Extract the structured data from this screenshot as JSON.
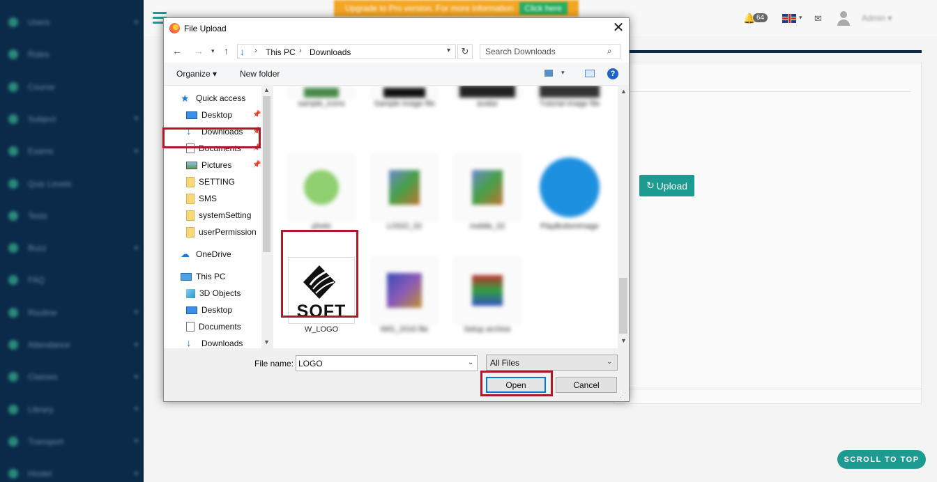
{
  "app": {
    "sidebar_items": [
      {
        "label": "Users",
        "caret": "▾"
      },
      {
        "label": "Roles",
        "caret": ""
      },
      {
        "label": "Course",
        "caret": ""
      },
      {
        "label": "Subject",
        "caret": "▾"
      },
      {
        "label": "Exams",
        "caret": "▾"
      },
      {
        "label": "Quiz Levels",
        "caret": ""
      },
      {
        "label": "Tests",
        "caret": ""
      },
      {
        "label": "Buzz",
        "caret": "▾"
      },
      {
        "label": "FAQ",
        "caret": ""
      },
      {
        "label": "Routine",
        "caret": "▾"
      },
      {
        "label": "Attendance",
        "caret": "▾"
      },
      {
        "label": "Classes",
        "caret": "▾"
      },
      {
        "label": "Library",
        "caret": "▾"
      },
      {
        "label": "Transport",
        "caret": "▾"
      },
      {
        "label": "Hostel",
        "caret": "▾"
      }
    ],
    "promo": {
      "text": "Upgrade to Pro version. For more information",
      "button": "Click here"
    },
    "notification_count": "64",
    "user_name": "Admin",
    "upload_button": "Upload",
    "scroll_to_top": "SCROLL TO TOP",
    "accent_color": "#1d9b91",
    "sidebar_color": "#0b2a4a"
  },
  "dialog": {
    "title": "File Upload",
    "close_glyph": "✕",
    "address": {
      "crumbs": [
        "This PC",
        "Downloads"
      ]
    },
    "search_placeholder": "Search Downloads",
    "toolbar": {
      "organize": "Organize ▾",
      "new_folder": "New folder"
    },
    "nav_tree": [
      {
        "label": "Quick access",
        "icon": "quick-access-icon",
        "pinned": false
      },
      {
        "label": "Desktop",
        "icon": "desktop-icon",
        "pinned": true
      },
      {
        "label": "Downloads",
        "icon": "downloads-icon",
        "pinned": true
      },
      {
        "label": "Documents",
        "icon": "documents-icon",
        "pinned": true
      },
      {
        "label": "Pictures",
        "icon": "pictures-icon",
        "pinned": true
      },
      {
        "label": "SETTING",
        "icon": "folder-icon",
        "pinned": false
      },
      {
        "label": "SMS",
        "icon": "folder-icon",
        "pinned": false
      },
      {
        "label": "systemSetting",
        "icon": "folder-icon",
        "pinned": false
      },
      {
        "label": "userPermission",
        "icon": "folder-icon",
        "pinned": false
      },
      {
        "label": "OneDrive",
        "icon": "onedrive-icon",
        "pinned": false
      },
      {
        "label": "This PC",
        "icon": "this-pc-icon",
        "pinned": false
      },
      {
        "label": "3D Objects",
        "icon": "3d-objects-icon",
        "pinned": false
      },
      {
        "label": "Desktop",
        "icon": "desktop-icon",
        "pinned": false
      },
      {
        "label": "Documents",
        "icon": "documents-icon",
        "pinned": false
      },
      {
        "label": "Downloads",
        "icon": "downloads-icon",
        "pinned": false
      }
    ],
    "files": {
      "selected_name": "W_LOGO",
      "selected_logo_text": "SOFT",
      "blurred_names": [
        "sample_icons",
        "Sample image file",
        "avatar",
        "Tutorial image file",
        "photo",
        "LOGO_02",
        "mobile_02",
        "PlayButtonImage",
        "IMG_2016 file",
        "Setup archive"
      ]
    },
    "file_name_label": "File name:",
    "file_name_value": "LOGO",
    "file_type": "All Files",
    "open_button": "Open",
    "cancel_button": "Cancel",
    "highlight_color": "#b0182a"
  }
}
